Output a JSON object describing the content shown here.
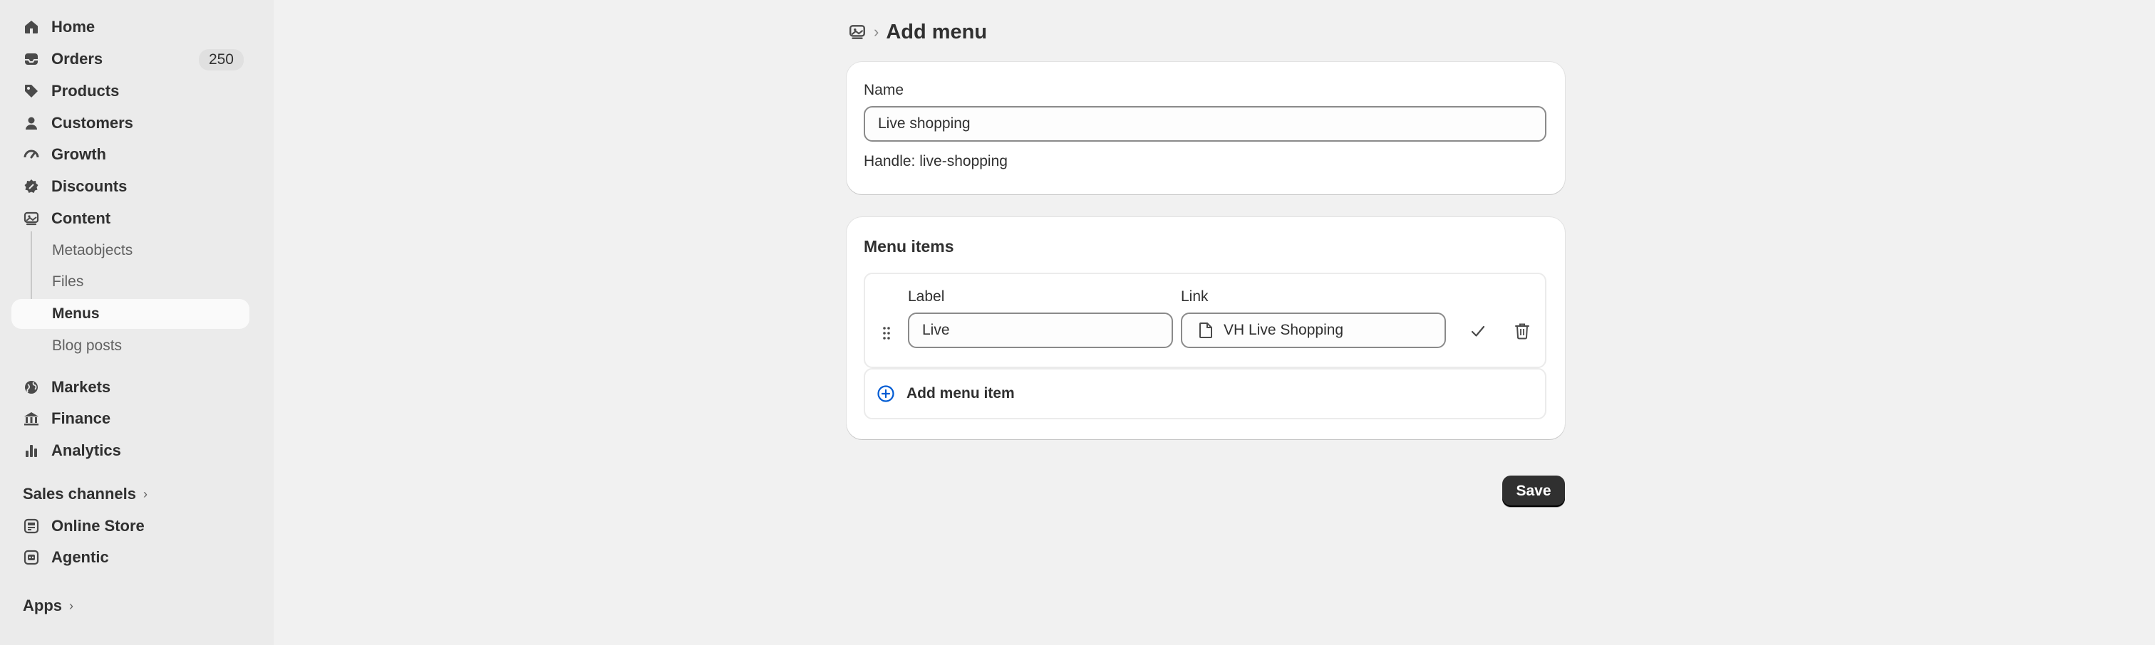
{
  "sidebar": {
    "items": [
      {
        "label": "Home",
        "icon": "home-icon"
      },
      {
        "label": "Orders",
        "icon": "orders-icon",
        "badge": "250"
      },
      {
        "label": "Products",
        "icon": "tag-icon"
      },
      {
        "label": "Customers",
        "icon": "person-icon"
      },
      {
        "label": "Growth",
        "icon": "gauge-icon"
      },
      {
        "label": "Discounts",
        "icon": "discount-icon"
      },
      {
        "label": "Content",
        "icon": "content-icon"
      }
    ],
    "content_sub": [
      {
        "label": "Metaobjects"
      },
      {
        "label": "Files"
      },
      {
        "label": "Menus",
        "active": true
      },
      {
        "label": "Blog posts"
      }
    ],
    "items2": [
      {
        "label": "Markets",
        "icon": "globe-icon"
      },
      {
        "label": "Finance",
        "icon": "bank-icon"
      },
      {
        "label": "Analytics",
        "icon": "bar-chart-icon"
      }
    ],
    "sales_channels_label": "Sales channels",
    "channels": [
      {
        "label": "Online Store",
        "icon": "store-icon"
      },
      {
        "label": "Agentic",
        "icon": "robot-icon"
      }
    ],
    "apps_label": "Apps"
  },
  "header": {
    "title": "Add menu",
    "crumb_icon": "content-icon"
  },
  "name_card": {
    "name_label": "Name",
    "name_value": "Live shopping",
    "handle_text": "Handle: live-shopping"
  },
  "menu_items_card": {
    "title": "Menu items",
    "label_header": "Label",
    "link_header": "Link",
    "items": [
      {
        "label_value": "Live",
        "link_value": "VH Live Shopping"
      }
    ],
    "add_label": "Add menu item"
  },
  "actions": {
    "save_label": "Save"
  },
  "colors": {
    "sidebar_bg": "#ebebeb",
    "page_bg": "#f1f1f1",
    "accent_blue": "#005bd3",
    "primary_button": "#303030"
  }
}
